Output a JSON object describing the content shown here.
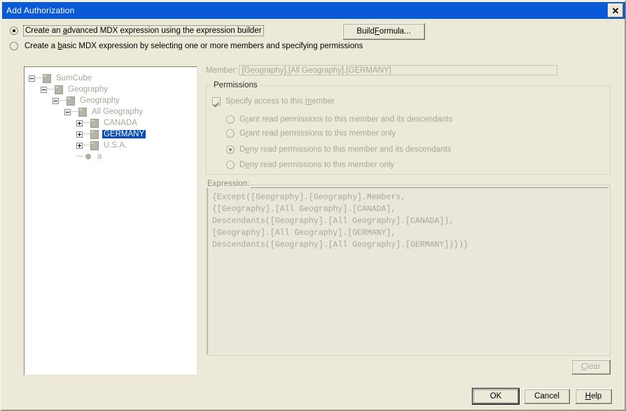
{
  "window": {
    "title": "Add Authorization",
    "close_icon": "close-icon",
    "close_glyph": "✕",
    "accent_titlebar": "#0a5ad8",
    "background": "#ece9d8",
    "selection_blue": "#0b4cb4"
  },
  "options": {
    "advanced": {
      "label": "Create an advanced MDX expression using the expression builder",
      "selected": true
    },
    "basic": {
      "label": "Create a basic MDX expression by selecting one or more members and specifying permissions",
      "selected": false
    },
    "build_formula_label": "Build Formula..."
  },
  "tree": {
    "nodes": [
      {
        "label": "SumCube",
        "depth": 0,
        "expander": "minus",
        "icon": "cube-icon",
        "selected": false
      },
      {
        "label": "Geography",
        "depth": 1,
        "expander": "minus",
        "icon": "cube-icon",
        "selected": false
      },
      {
        "label": "Geography",
        "depth": 2,
        "expander": "minus",
        "icon": "cube-icon",
        "selected": false
      },
      {
        "label": "All Geography",
        "depth": 3,
        "expander": "minus",
        "icon": "cube-icon",
        "selected": false
      },
      {
        "label": "CANADA",
        "depth": 4,
        "expander": "plus",
        "icon": "cube-icon",
        "selected": false
      },
      {
        "label": "GERMANY",
        "depth": 4,
        "expander": "plus",
        "icon": "cube-icon",
        "selected": true
      },
      {
        "label": "U.S.A.",
        "depth": 4,
        "expander": "plus",
        "icon": "cube-icon",
        "selected": false
      },
      {
        "label": "a",
        "depth": 4,
        "expander": "none",
        "icon": "bullet-icon",
        "selected": false
      }
    ]
  },
  "member": {
    "label": "Member:",
    "value": "[Geography].[All Geography].[GERMANY]"
  },
  "permissions": {
    "legend": "Permissions",
    "specify_access": {
      "label": "Specify access to this member",
      "checked": true,
      "enabled": false
    },
    "options": [
      {
        "label": "Grant read permissions to this member and its descendants",
        "selected": false
      },
      {
        "label": "Grant read permissions to this member only",
        "selected": false
      },
      {
        "label": "Deny read permissions to this member and its descendants",
        "selected": true
      },
      {
        "label": "Deny read permissions to this member only",
        "selected": false
      }
    ],
    "enabled": false
  },
  "expression": {
    "label": "Expression:",
    "lines": [
      "{Except([Geography].[Geography].Members,",
      "{[Geography].[All Geography].[CANADA],",
      "Descendants([Geography].[All Geography].[CANADA]),",
      "[Geography].[All Geography].[GERMANY],",
      "Descendants([Geography].[All Geography].[GERMANY])})}"
    ]
  },
  "buttons": {
    "clear": {
      "label": "Clear",
      "enabled": false
    },
    "ok": {
      "label": "OK",
      "enabled": true,
      "focused": true
    },
    "cancel": {
      "label": "Cancel",
      "enabled": true
    },
    "help": {
      "label": "Help",
      "enabled": true
    }
  }
}
